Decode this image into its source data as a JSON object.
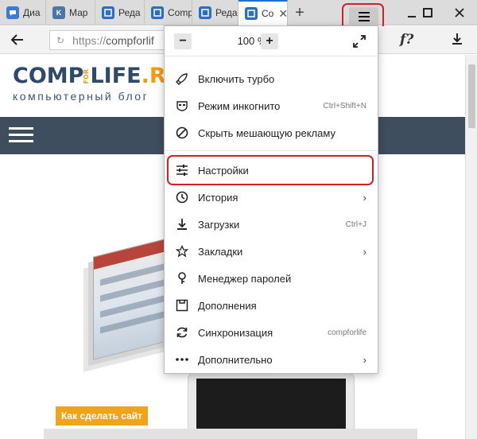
{
  "tabs": [
    {
      "label": "Диа",
      "icon": "dialog-icon",
      "color": "#3b7bd4"
    },
    {
      "label": "Мар",
      "icon": "vk-icon",
      "color": "#4a76a8"
    },
    {
      "label": "Реда",
      "icon": "editor-icon",
      "color": "#2c6fbf"
    },
    {
      "label": "Comp",
      "icon": "editor-icon",
      "color": "#2c6fbf"
    },
    {
      "label": "Реда",
      "icon": "editor-icon",
      "color": "#2c6fbf"
    },
    {
      "label": "Co",
      "icon": "editor-icon",
      "color": "#2c6fbf",
      "active": true
    }
  ],
  "address": {
    "scheme": "https://",
    "host": "compforlif"
  },
  "site": {
    "logo_left": "COMP",
    "logo_for": "FOR",
    "logo_right": "LIFE",
    "logo_domain": ".RU",
    "tagline": "компьютерный блог",
    "cta": "Как сделать сайт"
  },
  "menu": {
    "zoom": "100 %",
    "zoom_minus": "−",
    "zoom_plus": "+",
    "items": [
      {
        "label": "Включить турбо",
        "icon": "rocket-icon",
        "shortcut": ""
      },
      {
        "label": "Режим инкогнито",
        "icon": "incognito-icon",
        "shortcut": "Ctrl+Shift+N"
      },
      {
        "label": "Скрыть мешающую рекламу",
        "icon": "block-ads-icon",
        "shortcut": ""
      },
      {
        "label": "Настройки",
        "icon": "settings-sliders-icon",
        "shortcut": "",
        "highlighted": true
      },
      {
        "label": "История",
        "icon": "history-icon",
        "shortcut": "",
        "submenu": true
      },
      {
        "label": "Загрузки",
        "icon": "download-icon",
        "shortcut": "Ctrl+J"
      },
      {
        "label": "Закладки",
        "icon": "star-icon",
        "shortcut": "",
        "submenu": true
      },
      {
        "label": "Менеджер паролей",
        "icon": "key-icon",
        "shortcut": ""
      },
      {
        "label": "Дополнения",
        "icon": "extensions-icon",
        "shortcut": ""
      },
      {
        "label": "Синхронизация",
        "icon": "sync-icon",
        "shortcut": "compforlife"
      },
      {
        "label": "Дополнительно",
        "icon": "more-icon",
        "shortcut": "",
        "submenu": true
      }
    ],
    "submenu_glyph": "›"
  },
  "colors": {
    "highlight": "#d21f2a",
    "accent": "#1a73c8",
    "nav": "#3e4e5e",
    "cta": "#f0a41c"
  }
}
